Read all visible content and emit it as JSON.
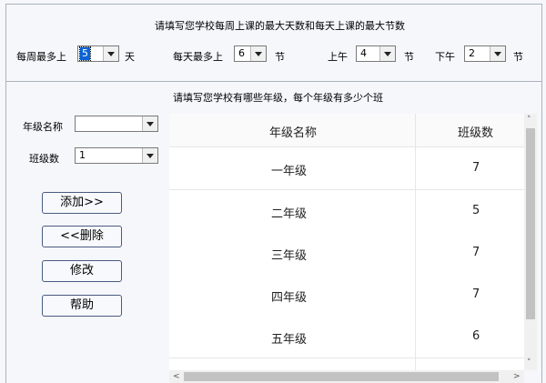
{
  "top": {
    "title": "请填写您学校每周上课的最大天数和每天上课的最大节数",
    "week_label": "每周最多上",
    "week_value": "5",
    "week_unit": "天",
    "day_label": "每天最多上",
    "day_value": "6",
    "day_unit": "节",
    "am_label": "上午",
    "am_value": "4",
    "am_unit": "节",
    "pm_label": "下午",
    "pm_value": "2",
    "pm_unit": "节"
  },
  "middle": {
    "title": "请填写您学校有哪些年级，每个年级有多少个班"
  },
  "form": {
    "grade_name_label": "年级名称",
    "grade_name_value": "",
    "class_count_label": "班级数",
    "class_count_value": "1"
  },
  "buttons": {
    "add": "添加>>",
    "delete": "<<删除",
    "modify": "修改",
    "help": "帮助"
  },
  "table": {
    "columns": [
      "年级名称",
      "班级数"
    ],
    "rows": [
      {
        "grade": "一年级",
        "classes": "7"
      },
      {
        "grade": "二年级",
        "classes": "5"
      },
      {
        "grade": "三年级",
        "classes": "7"
      },
      {
        "grade": "四年级",
        "classes": "7"
      },
      {
        "grade": "五年级",
        "classes": "6"
      }
    ]
  },
  "scrollbar": {
    "up": "˄",
    "down": "˅",
    "left": "<",
    "right": ">"
  }
}
